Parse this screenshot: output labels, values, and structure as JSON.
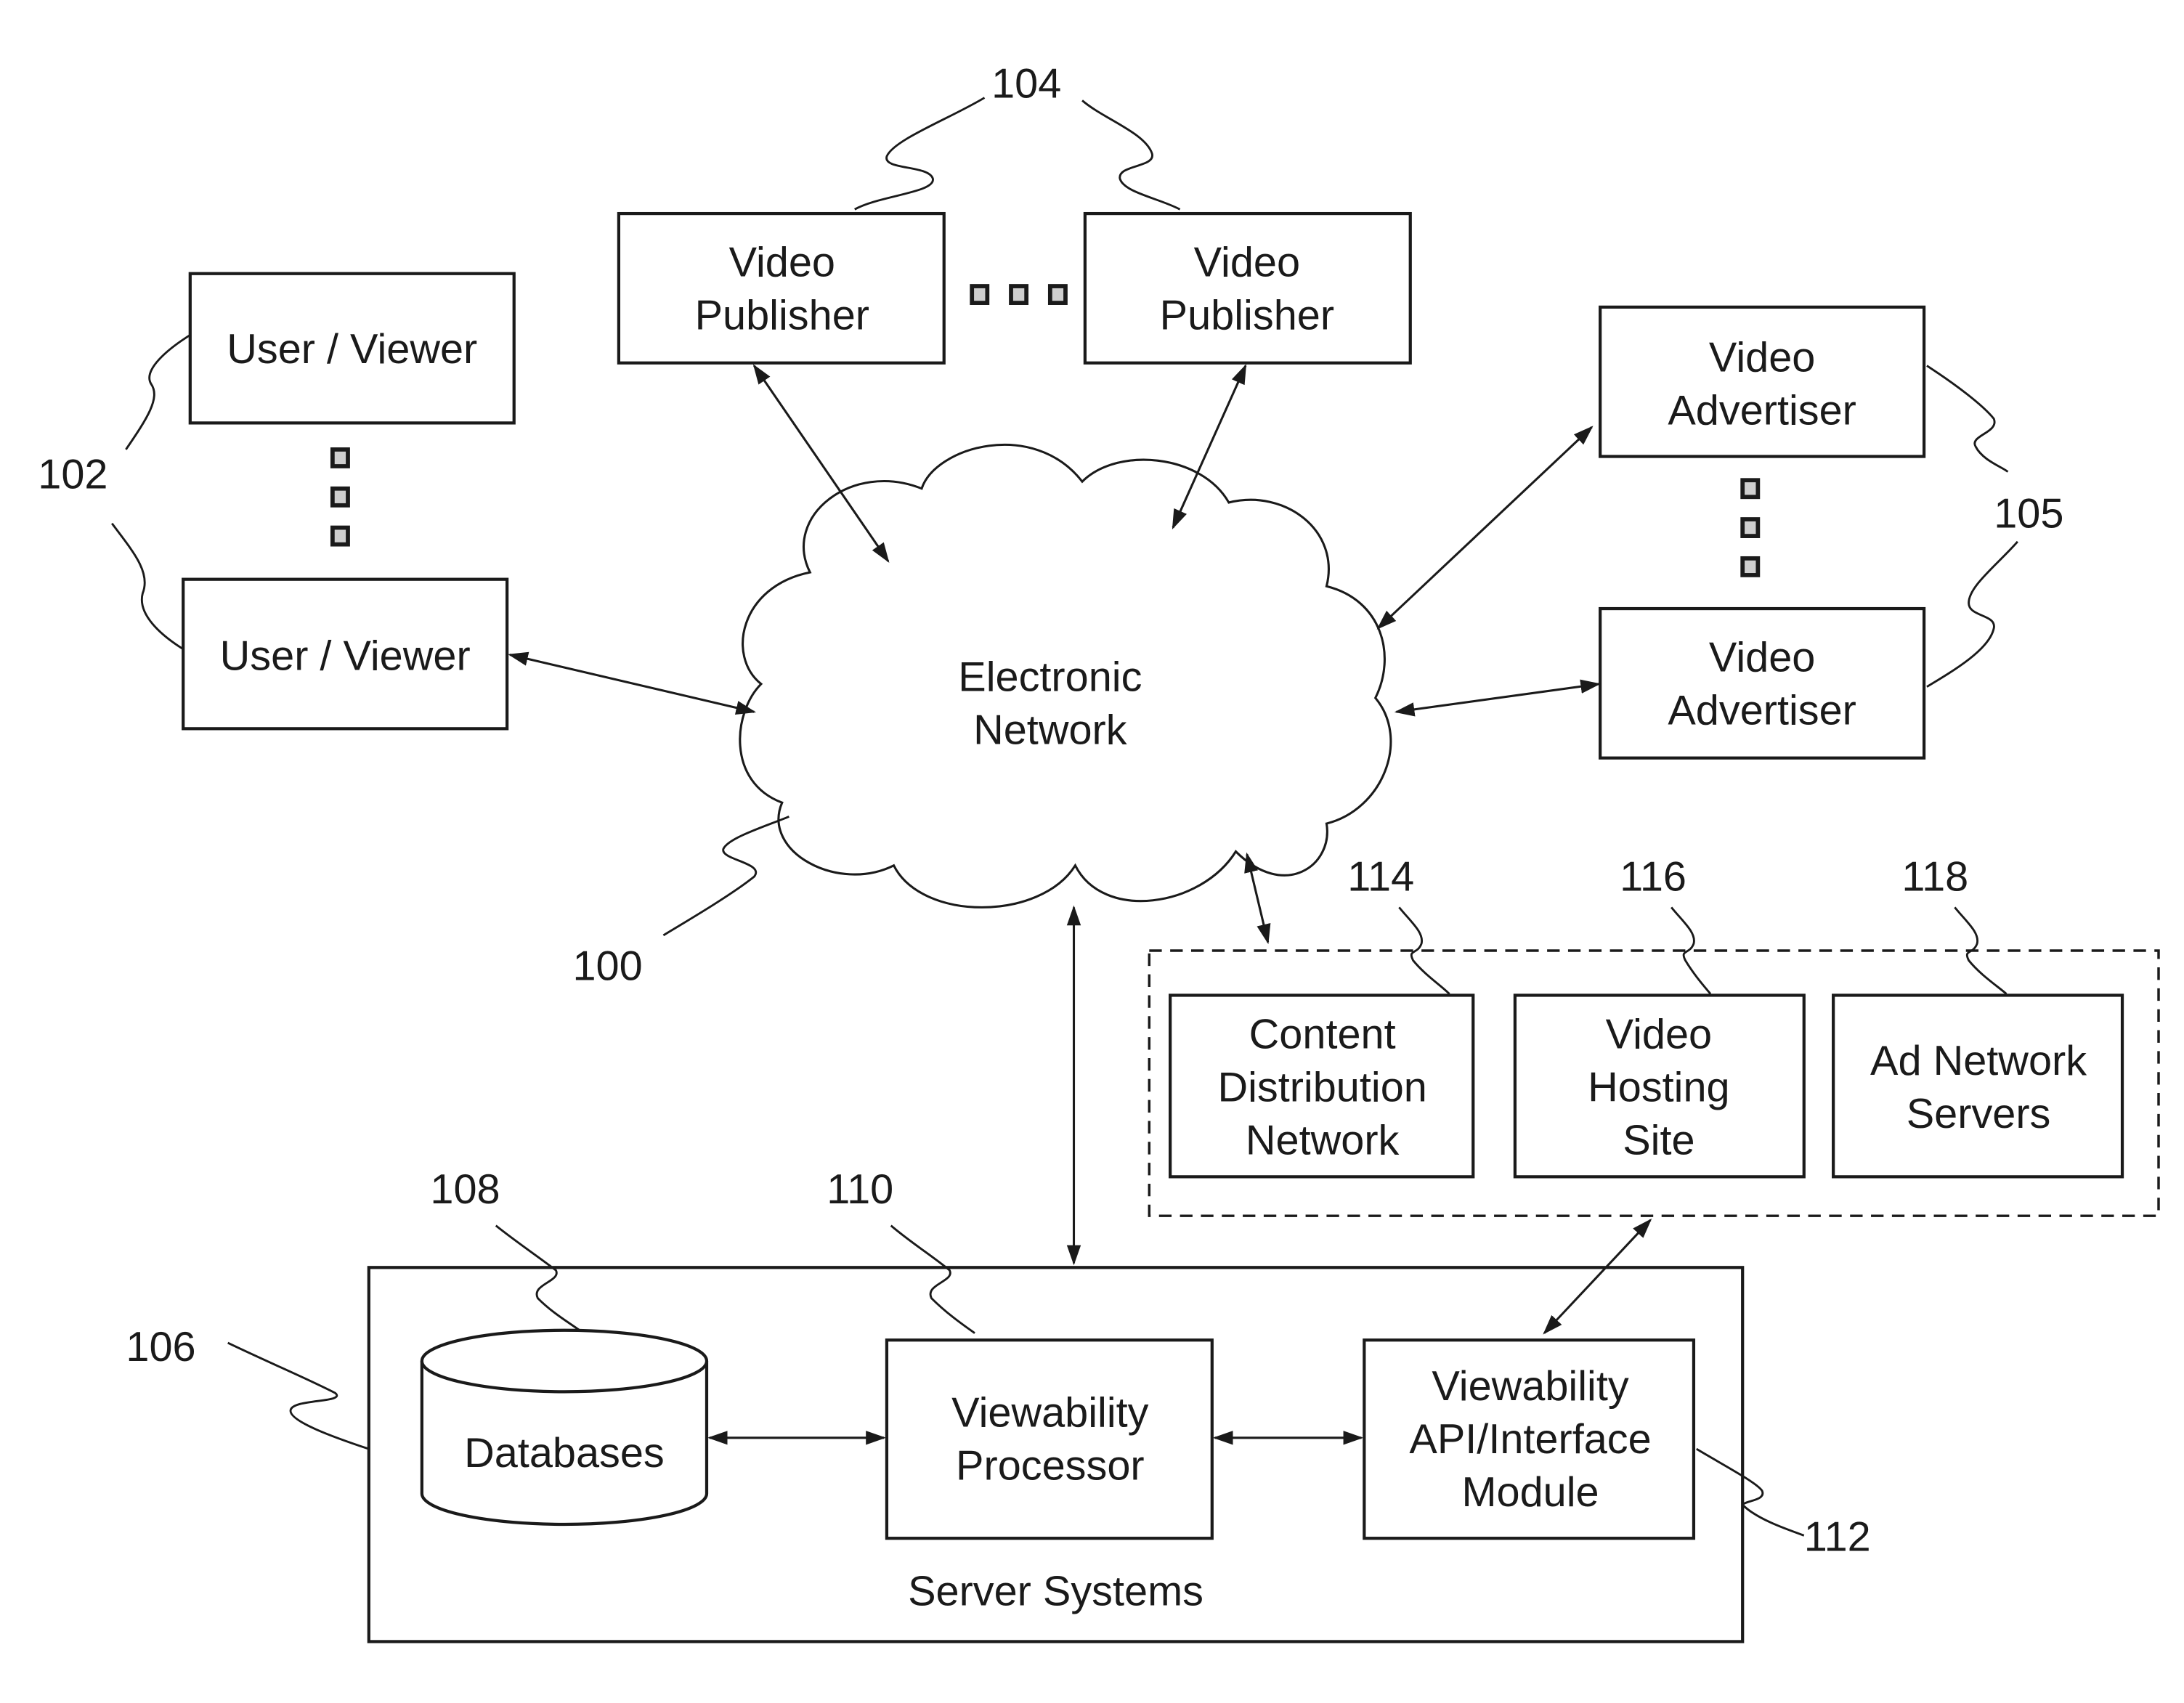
{
  "diagram": {
    "nodes": {
      "user_viewer_1": {
        "lines": [
          "User / Viewer"
        ]
      },
      "user_viewer_2": {
        "lines": [
          "User / Viewer"
        ]
      },
      "video_publisher_1": {
        "lines": [
          "Video",
          "Publisher"
        ]
      },
      "video_publisher_2": {
        "lines": [
          "Video",
          "Publisher"
        ]
      },
      "video_advertiser_1": {
        "lines": [
          "Video",
          "Advertiser"
        ]
      },
      "video_advertiser_2": {
        "lines": [
          "Video",
          "Advertiser"
        ]
      },
      "electronic_network": {
        "lines": [
          "Electronic",
          "Network"
        ]
      },
      "content_distribution_network": {
        "lines": [
          "Content",
          "Distribution",
          "Network"
        ]
      },
      "video_hosting_site": {
        "lines": [
          "Video",
          "Hosting",
          "Site"
        ]
      },
      "ad_network_servers": {
        "lines": [
          "Ad Network",
          "Servers"
        ]
      },
      "databases": {
        "lines": [
          "Databases"
        ]
      },
      "viewability_processor": {
        "lines": [
          "Viewability",
          "Processor"
        ]
      },
      "viewability_api": {
        "lines": [
          "Viewability",
          "API/Interface",
          "Module"
        ]
      },
      "server_systems": {
        "lines": [
          "Server Systems"
        ]
      }
    },
    "reference_numbers": {
      "network": "100",
      "user_viewers": "102",
      "video_publishers": "104",
      "video_advertisers": "105",
      "server_systems": "106",
      "databases": "108",
      "viewability_processor": "110",
      "viewability_api": "112",
      "content_distribution_network": "114",
      "video_hosting_site": "116",
      "ad_network_servers": "118"
    },
    "edges": [
      {
        "from": "user_viewer_2",
        "to": "electronic_network",
        "direction": "bidirectional"
      },
      {
        "from": "video_publisher_1",
        "to": "electronic_network",
        "direction": "bidirectional"
      },
      {
        "from": "video_publisher_2",
        "to": "electronic_network",
        "direction": "bidirectional"
      },
      {
        "from": "video_advertiser_1",
        "to": "electronic_network",
        "direction": "bidirectional"
      },
      {
        "from": "video_advertiser_2",
        "to": "electronic_network",
        "direction": "bidirectional"
      },
      {
        "from": "electronic_network",
        "to": "third_party_group",
        "direction": "bidirectional"
      },
      {
        "from": "electronic_network",
        "to": "server_systems",
        "direction": "bidirectional"
      },
      {
        "from": "third_party_group",
        "to": "viewability_api",
        "direction": "bidirectional"
      },
      {
        "from": "databases",
        "to": "viewability_processor",
        "direction": "bidirectional"
      },
      {
        "from": "viewability_processor",
        "to": "viewability_api",
        "direction": "bidirectional"
      }
    ],
    "ellipsis_markers": [
      "between user viewers",
      "between video publishers",
      "between video advertisers"
    ]
  }
}
